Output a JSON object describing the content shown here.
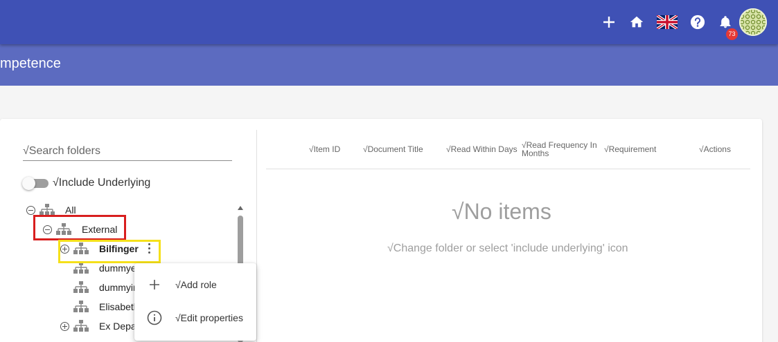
{
  "header": {
    "icons": [
      "add-icon",
      "home-icon",
      "uk-flag-icon",
      "help-icon",
      "notifications-icon"
    ],
    "notification_count": "73"
  },
  "page": {
    "title": "mpetence"
  },
  "folders": {
    "search_placeholder": "√Search folders",
    "include_underlying_label": "√Include Underlying",
    "tree": [
      {
        "label": "All",
        "expander": "collapse"
      },
      {
        "label": "External",
        "expander": "collapse"
      },
      {
        "label": "Bilfinger",
        "expander": "expand"
      },
      {
        "label": "dummye",
        "expander": "none"
      },
      {
        "label": "dummyir",
        "expander": "none"
      },
      {
        "label": "Elisabeth",
        "expander": "none"
      },
      {
        "label": "Ex Depar",
        "expander": "expand"
      }
    ]
  },
  "context_menu": {
    "items": [
      {
        "label": "√Add role",
        "icon": "plus-icon"
      },
      {
        "label": "√Edit properties",
        "icon": "info-icon"
      }
    ]
  },
  "table": {
    "columns": [
      "√Item ID",
      "√Document Title",
      "√Read Within Days",
      "√Read Frequency In Months",
      "√Requirement",
      "√Actions"
    ],
    "empty_title": "√No items",
    "empty_hint": "√Change folder or select 'include underlying' icon"
  },
  "colors": {
    "toolbar": "#3f51b5",
    "subheader": "#5c6bc0",
    "badge": "#e53935",
    "highlight_red": "#d81e1e",
    "highlight_yellow": "#f5e01a"
  }
}
